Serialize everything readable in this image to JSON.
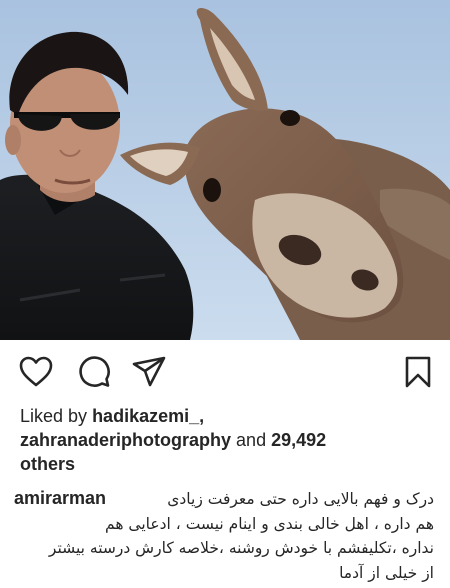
{
  "post": {
    "likes": {
      "prefix": "Liked by",
      "user1": "hadikazemi_,",
      "user2": "zahranaderiphotography",
      "and_text": "and",
      "count": "29,492",
      "suffix": "others"
    },
    "caption": {
      "author": "amirarman",
      "lines": [
        "درک و فهم بالایی داره حتی معرفت زیادی",
        "هم داره ، اهل خالی بندی و اینام نیست ، ادعایی هم",
        "نداره ،تکلیفشم با خودش روشنه ،خلاصه کارش درسته بیشتر",
        "از خیلی از آدما"
      ]
    },
    "actions": {
      "like_icon": "heart-icon",
      "comment_icon": "speech-bubble-icon",
      "share_icon": "paper-plane-icon",
      "save_icon": "bookmark-icon"
    },
    "colors": {
      "sky": "#b9cfe6",
      "text": "#262626"
    }
  }
}
